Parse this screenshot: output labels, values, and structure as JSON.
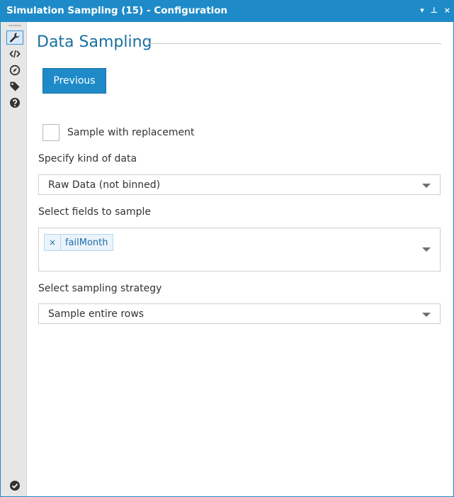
{
  "window": {
    "title": "Simulation Sampling (15) - Configuration",
    "controls": {
      "dropdown": "▾",
      "pin": "⊥",
      "close": "×"
    }
  },
  "rail": {
    "tools": [
      {
        "icon": "wrench-icon",
        "active": true
      },
      {
        "icon": "code-icon",
        "active": false
      },
      {
        "icon": "compass-icon",
        "active": false
      },
      {
        "icon": "tag-icon",
        "active": false
      },
      {
        "icon": "help-icon",
        "active": false
      }
    ],
    "status_icon": "check-circle-icon"
  },
  "main": {
    "heading": "Data Sampling",
    "previous_button": "Previous",
    "replacement": {
      "label": "Sample with replacement",
      "checked": false
    },
    "kind_of_data": {
      "label": "Specify kind of data",
      "value": "Raw Data (not binned)"
    },
    "fields": {
      "label": "Select fields to sample",
      "selected": [
        "failMonth"
      ],
      "remove_glyph": "×"
    },
    "strategy": {
      "label": "Select sampling strategy",
      "value": "Sample entire rows"
    }
  },
  "colors": {
    "accent": "#1e8bc8",
    "heading": "#1a6f9f",
    "rail_background": "#e6e6e6"
  }
}
